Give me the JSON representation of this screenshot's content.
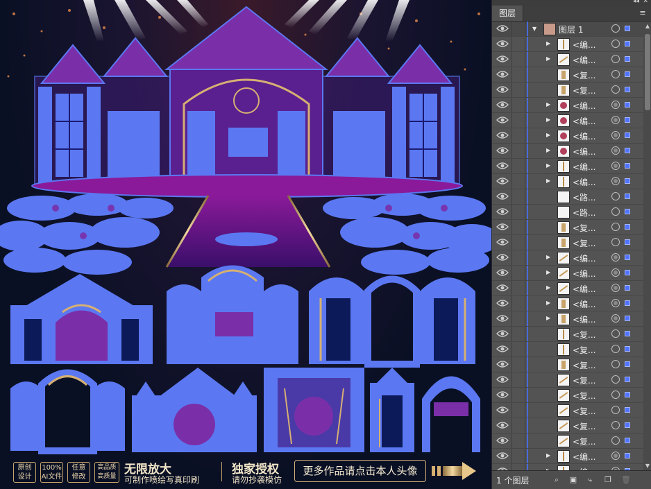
{
  "panel": {
    "tab_label": "图层",
    "top_icons": "◂◂ ✕",
    "menu_icon": "≡",
    "layer_count": "1 个图层",
    "parent_layer": {
      "name": "图层 1"
    },
    "rows": [
      {
        "name": "<编...",
        "expand": true,
        "thumb": "line",
        "target": "hollow"
      },
      {
        "name": "<编...",
        "expand": true,
        "thumb": "diag",
        "target": "hollow"
      },
      {
        "name": "<复...",
        "expand": false,
        "thumb": "gold",
        "target": "hollow"
      },
      {
        "name": "<复...",
        "expand": false,
        "thumb": "gold",
        "target": "hollow"
      },
      {
        "name": "<编...",
        "expand": true,
        "thumb": "ring",
        "target": "filled"
      },
      {
        "name": "<编...",
        "expand": true,
        "thumb": "ring",
        "target": "filled"
      },
      {
        "name": "<编...",
        "expand": true,
        "thumb": "ring",
        "target": "filled"
      },
      {
        "name": "<编...",
        "expand": true,
        "thumb": "ring",
        "target": "filled"
      },
      {
        "name": "<编...",
        "expand": true,
        "thumb": "line",
        "target": "filled"
      },
      {
        "name": "<编...",
        "expand": true,
        "thumb": "line",
        "target": "filled"
      },
      {
        "name": "<路...",
        "expand": false,
        "thumb": "plain",
        "target": "hollow"
      },
      {
        "name": "<路...",
        "expand": false,
        "thumb": "plain",
        "target": "hollow"
      },
      {
        "name": "<复...",
        "expand": false,
        "thumb": "gold",
        "target": "hollow"
      },
      {
        "name": "<复...",
        "expand": false,
        "thumb": "gold",
        "target": "hollow"
      },
      {
        "name": "<编...",
        "expand": true,
        "thumb": "diag",
        "target": "filled"
      },
      {
        "name": "<编...",
        "expand": true,
        "thumb": "diag",
        "target": "filled"
      },
      {
        "name": "<编...",
        "expand": true,
        "thumb": "diag",
        "target": "filled"
      },
      {
        "name": "<编...",
        "expand": true,
        "thumb": "gold",
        "target": "filled"
      },
      {
        "name": "<编...",
        "expand": true,
        "thumb": "gold",
        "target": "filled"
      },
      {
        "name": "<复...",
        "expand": false,
        "thumb": "line",
        "target": "hollow"
      },
      {
        "name": "<复...",
        "expand": false,
        "thumb": "line",
        "target": "hollow"
      },
      {
        "name": "<复...",
        "expand": false,
        "thumb": "gold",
        "target": "hollow"
      },
      {
        "name": "<复...",
        "expand": false,
        "thumb": "diag",
        "target": "hollow"
      },
      {
        "name": "<复...",
        "expand": false,
        "thumb": "diag",
        "target": "hollow"
      },
      {
        "name": "<复...",
        "expand": false,
        "thumb": "diag",
        "target": "hollow"
      },
      {
        "name": "<复...",
        "expand": false,
        "thumb": "diag",
        "target": "hollow"
      },
      {
        "name": "<复...",
        "expand": false,
        "thumb": "diag",
        "target": "hollow"
      },
      {
        "name": "<编...",
        "expand": true,
        "thumb": "line",
        "target": "filled"
      },
      {
        "name": "<编...",
        "expand": true,
        "thumb": "line",
        "target": "filled"
      },
      {
        "name": "<编...",
        "expand": true,
        "thumb": "dark",
        "target": "filled"
      }
    ],
    "bottom_icons": [
      "locate-object-icon",
      "make-clipping-mask-icon",
      "create-sublayer-icon",
      "create-new-layer-icon",
      "delete-layer-icon"
    ]
  },
  "banner": {
    "badges": [
      {
        "line1": "原创",
        "line2": "设计"
      },
      {
        "line1": "100%",
        "line2": "AI文件"
      },
      {
        "line1": "任意",
        "line2": "修改"
      },
      {
        "line1": "高品质",
        "line2": "高质量"
      }
    ],
    "headline1": "无限放大",
    "sub1": "可制作喷绘写真印刷",
    "headline2": "独家授权",
    "sub2": "请勿抄袭模仿",
    "cta": "更多作品请点击本人头像"
  },
  "colors": {
    "artwork_blue": "#5b78f2",
    "artwork_purple": "#7a2fa8",
    "gold": "#d6b072",
    "panel_bg": "#535353",
    "selection_blue": "#4a6bdc"
  }
}
